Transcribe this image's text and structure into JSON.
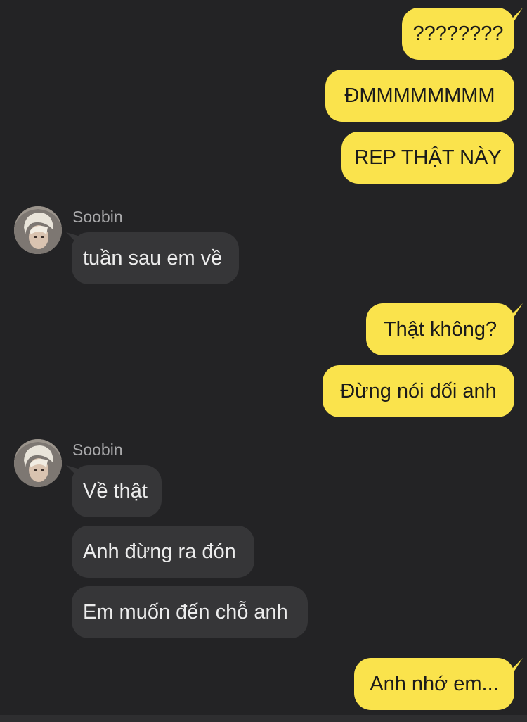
{
  "chat": {
    "messages": [
      {
        "from": "me",
        "text": "????????"
      },
      {
        "from": "me",
        "text": "ĐMMMMMMMM"
      },
      {
        "from": "me",
        "text": "REP THẬT NÀY"
      },
      {
        "from": "Soobin",
        "sender_label": "Soobin",
        "text": "tuần sau em về"
      },
      {
        "from": "me",
        "text": "Thật không?"
      },
      {
        "from": "me",
        "text": "Đừng nói dối anh"
      },
      {
        "from": "Soobin",
        "sender_label": "Soobin",
        "text": "Về thật"
      },
      {
        "from": "Soobin",
        "text": "Anh đừng ra đón"
      },
      {
        "from": "Soobin",
        "text": "Em muốn đến chỗ anh"
      },
      {
        "from": "me",
        "text": "Anh nhớ em..."
      }
    ]
  },
  "colors": {
    "background": "#232325",
    "outgoing_bubble": "#fae34c",
    "incoming_bubble": "#363638",
    "incoming_text": "#ececec",
    "sender_name": "#a8a8aa"
  },
  "icons": {
    "avatar": "avatar-soobin"
  }
}
